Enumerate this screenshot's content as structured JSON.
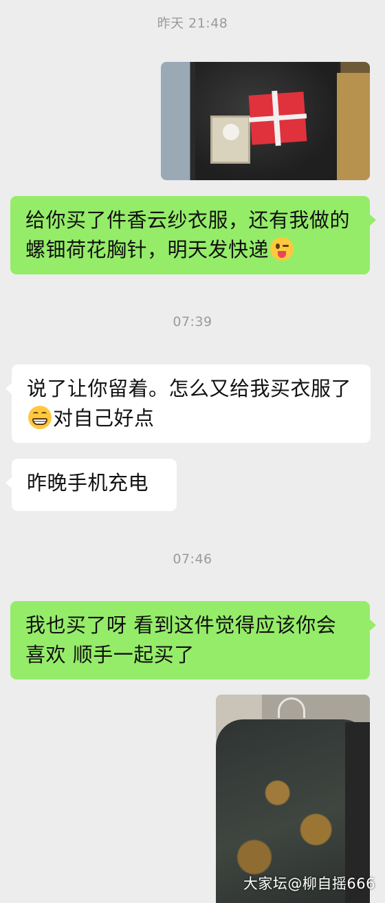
{
  "timestamps": [
    "昨天 21:48",
    "07:39",
    "07:46"
  ],
  "messages": [
    {
      "type": "image",
      "side": "out",
      "content": "gift-package-photo"
    },
    {
      "type": "text",
      "side": "out",
      "text": "给你买了件香云纱衣服，还有我做的螺钿荷花胸针，明天发快递",
      "emoji": "winking-tongue-emoji"
    },
    {
      "type": "text",
      "side": "in",
      "text_a": "说了让你留着。怎么又给我买衣服了",
      "emoji": "grinning-emoji",
      "text_b": "对自己好点"
    },
    {
      "type": "text",
      "side": "in",
      "text": "昨晚手机充电"
    },
    {
      "type": "text",
      "side": "out",
      "text": "我也买了呀 看到这件觉得应该你会喜欢 顺手一起买了"
    },
    {
      "type": "image",
      "side": "out",
      "content": "xiangyunsha-blouse-photo"
    }
  ],
  "watermark": "大家坛@柳自摇666",
  "colors": {
    "background": "#ededed",
    "outgoing": "#95ec69",
    "incoming": "#ffffff",
    "timestamp": "#9a9a9a"
  }
}
